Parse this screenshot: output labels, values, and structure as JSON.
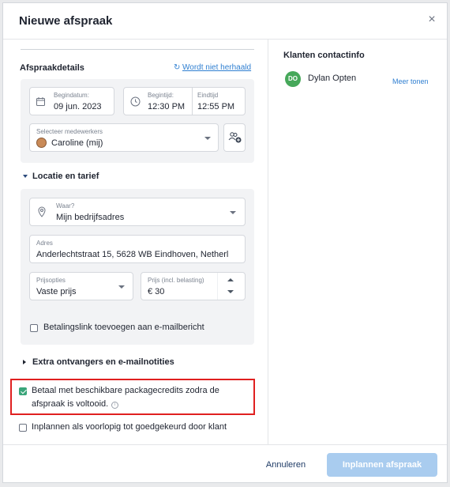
{
  "modal": {
    "title": "Nieuwe afspraak",
    "close_label": "×"
  },
  "details": {
    "section_title": "Afspraakdetails",
    "repeat_link": "Wordt niet herhaald",
    "start_date": {
      "label": "Begindatum:",
      "value": "09 jun. 2023"
    },
    "start_time": {
      "label": "Begintijd:",
      "value": "12:30 PM"
    },
    "end_time": {
      "label": "Eindtijd",
      "value": "12:55 PM"
    },
    "staff": {
      "label": "Selecteer medewerkers",
      "value": "Caroline (mij)"
    }
  },
  "location": {
    "section_title": "Locatie en tarief",
    "where": {
      "label": "Waar?",
      "value": "Mijn bedrijfsadres"
    },
    "address": {
      "label": "Adres",
      "value": "Anderlechtstraat 15, 5628 WB Eindhoven, Netherl"
    },
    "price_option": {
      "label": "Prijsopties",
      "value": "Vaste prijs"
    },
    "price": {
      "label": "Prijs (incl. belasting)",
      "value": "€ 30"
    },
    "payment_link": {
      "label": "Betalingslink toevoegen aan e-mailbericht",
      "checked": false
    }
  },
  "extra": {
    "section_title": "Extra ontvangers en e-mailnotities"
  },
  "package_credits": {
    "line1": "Betaal met beschikbare packagecredits zodra de",
    "line2": "afspraak is voltooid.",
    "checked": true
  },
  "provisional": {
    "label": "Inplannen als voorlopig tot goedgekeurd door klant",
    "checked": false
  },
  "contact": {
    "section_title": "Klanten contactinfo",
    "initials": "DO",
    "name": "Dylan Opten",
    "more_link": "Meer tonen"
  },
  "footer": {
    "cancel_label": "Annuleren",
    "submit_label": "Inplannen afspraak"
  },
  "colors": {
    "accent": "#2f7fd1",
    "check_green": "#3aa57a",
    "primary_disabled": "#a9ccef",
    "highlight_red": "#e02020",
    "avatar_green": "#46a85a"
  }
}
